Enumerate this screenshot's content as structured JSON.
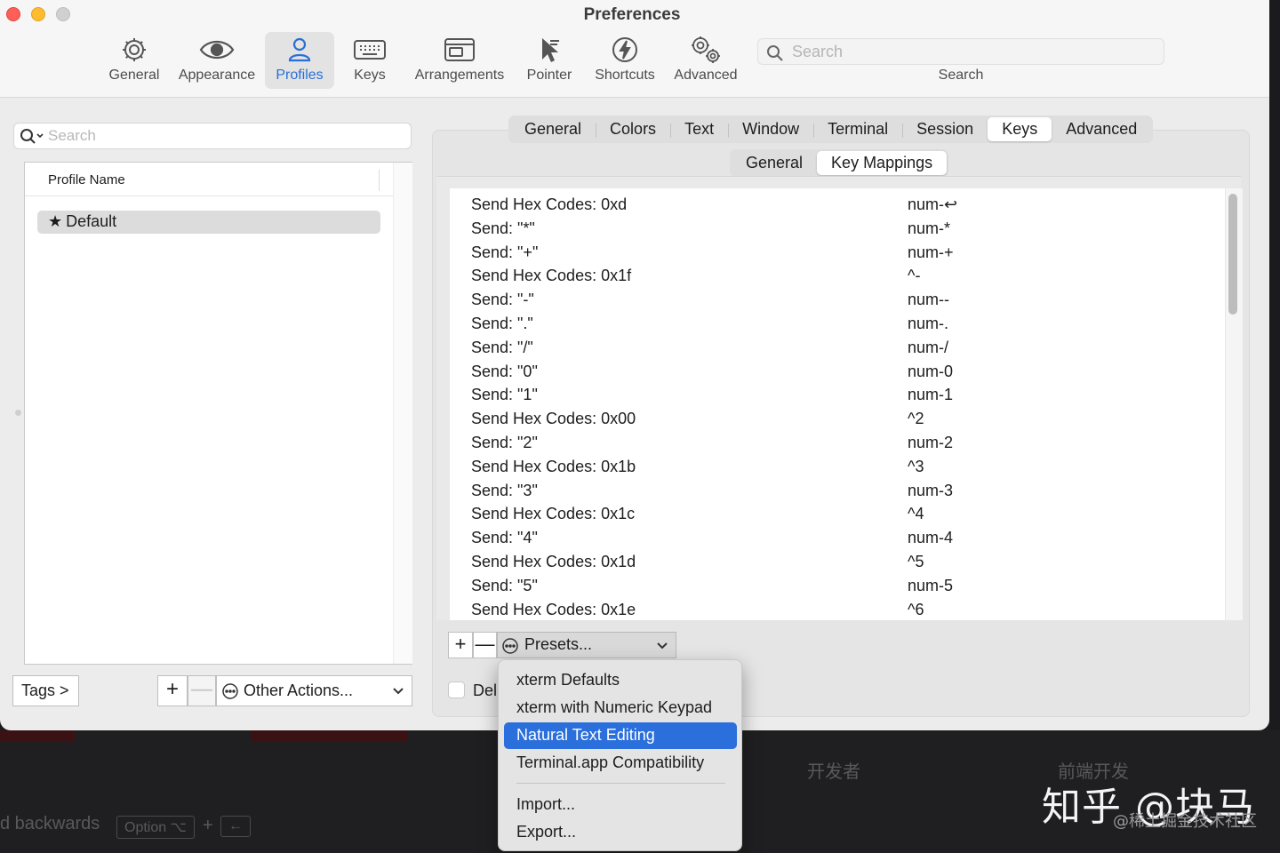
{
  "window": {
    "title": "Preferences"
  },
  "toolbar": {
    "items": [
      {
        "label": "General",
        "icon": "gear-icon"
      },
      {
        "label": "Appearance",
        "icon": "eye-icon"
      },
      {
        "label": "Profiles",
        "icon": "person-icon",
        "active": true
      },
      {
        "label": "Keys",
        "icon": "keyboard-icon"
      },
      {
        "label": "Arrangements",
        "icon": "window-icon"
      },
      {
        "label": "Pointer",
        "icon": "pointer-icon"
      },
      {
        "label": "Shortcuts",
        "icon": "bolt-icon"
      },
      {
        "label": "Advanced",
        "icon": "gears-icon"
      }
    ],
    "search_placeholder": "Search",
    "search_label": "Search"
  },
  "profiles": {
    "search_placeholder": "Search",
    "column_header": "Profile Name",
    "rows": [
      {
        "name": "Default",
        "star": "★"
      }
    ],
    "tags_button": "Tags >",
    "add_button": "+",
    "remove_button": "—",
    "other_actions": "Other Actions..."
  },
  "tabs": {
    "main": [
      "General",
      "Colors",
      "Text",
      "Window",
      "Terminal",
      "Session",
      "Keys",
      "Advanced"
    ],
    "main_selected": "Keys",
    "sub": [
      "General",
      "Key Mappings"
    ],
    "sub_selected": "Key Mappings"
  },
  "key_mappings": {
    "rows": [
      {
        "action": "Send Hex Codes: 0xd",
        "key": "num-↩"
      },
      {
        "action": "Send: \"*\"",
        "key": "num-*"
      },
      {
        "action": "Send: \"+\"",
        "key": "num-+"
      },
      {
        "action": "Send Hex Codes: 0x1f",
        "key": "^-"
      },
      {
        "action": "Send: \"-\"",
        "key": "num--"
      },
      {
        "action": "Send: \".\"",
        "key": "num-."
      },
      {
        "action": "Send: \"/\"",
        "key": "num-/"
      },
      {
        "action": "Send: \"0\"",
        "key": "num-0"
      },
      {
        "action": "Send: \"1\"",
        "key": "num-1"
      },
      {
        "action": "Send Hex Codes: 0x00",
        "key": "^2"
      },
      {
        "action": "Send: \"2\"",
        "key": "num-2"
      },
      {
        "action": "Send Hex Codes: 0x1b",
        "key": "^3"
      },
      {
        "action": "Send: \"3\"",
        "key": "num-3"
      },
      {
        "action": "Send Hex Codes: 0x1c",
        "key": "^4"
      },
      {
        "action": "Send: \"4\"",
        "key": "num-4"
      },
      {
        "action": "Send Hex Codes: 0x1d",
        "key": "^5"
      },
      {
        "action": "Send: \"5\"",
        "key": "num-5"
      },
      {
        "action": "Send Hex Codes: 0x1e",
        "key": "^6"
      }
    ],
    "add_button": "+",
    "remove_button": "—",
    "presets_button": "Presets...",
    "delete_label": "Del"
  },
  "presets_menu": {
    "items": [
      "xterm Defaults",
      "xterm with Numeric Keypad",
      "Natural Text Editing",
      "Terminal.app Compatibility"
    ],
    "highlighted": "Natural Text Editing",
    "items_after_separator": [
      "Import...",
      "Export..."
    ]
  },
  "background": {
    "text_backwards": "d backwards",
    "key_option": "Option ⌥",
    "key_plus": "+",
    "key_left": "←",
    "cn_text_1": "开发者",
    "cn_text_2": "前端开发"
  },
  "watermark": {
    "main": "知乎 @块马",
    "sub": "@稀土掘金技术社区"
  },
  "colors": {
    "accent": "#2a6fdb",
    "close": "#ff5f57",
    "minimize": "#febc2e"
  }
}
